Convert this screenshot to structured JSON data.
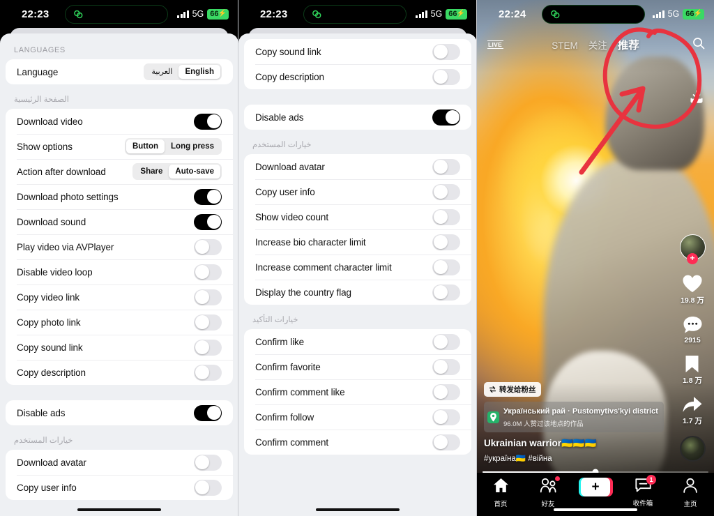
{
  "status_bar": {
    "time_left": "22:23",
    "time_right": "22:24",
    "network": "5G",
    "battery": "66",
    "charging_glyph": "⚡",
    "island_icon": "green-link-icon"
  },
  "panel1": {
    "sections": [
      {
        "header": "LANGUAGES",
        "rtl": false,
        "rows": [
          {
            "label": "Language",
            "control": "segmented",
            "options": [
              "العربية",
              "English"
            ],
            "selected": "English"
          }
        ]
      },
      {
        "header": "الصفحة الرئيسية",
        "rtl": true,
        "rows": [
          {
            "label": "Download video",
            "control": "toggle",
            "value": "on"
          },
          {
            "label": "Show options",
            "control": "segmented",
            "options": [
              "Button",
              "Long press"
            ],
            "selected": "Button"
          },
          {
            "label": "Action after download",
            "control": "segmented",
            "options": [
              "Share",
              "Auto-save"
            ],
            "selected": "Auto-save"
          },
          {
            "label": "Download photo settings",
            "control": "toggle",
            "value": "on"
          },
          {
            "label": "Download sound",
            "control": "toggle",
            "value": "on"
          },
          {
            "label": "Play video via AVPlayer",
            "control": "toggle",
            "value": "off"
          },
          {
            "label": "Disable video loop",
            "control": "toggle",
            "value": "off"
          },
          {
            "label": "Copy video link",
            "control": "toggle",
            "value": "off"
          },
          {
            "label": "Copy photo link",
            "control": "toggle",
            "value": "off"
          },
          {
            "label": "Copy sound link",
            "control": "toggle",
            "value": "off"
          },
          {
            "label": "Copy description",
            "control": "toggle",
            "value": "off"
          }
        ]
      },
      {
        "header": "",
        "rtl": false,
        "rows": [
          {
            "label": "Disable ads",
            "control": "toggle",
            "value": "on"
          }
        ]
      },
      {
        "header": "خيارات المستخدم",
        "rtl": true,
        "rows": [
          {
            "label": "Download avatar",
            "control": "toggle",
            "value": "off"
          },
          {
            "label": "Copy user info",
            "control": "toggle",
            "value": "off"
          }
        ]
      }
    ]
  },
  "panel2": {
    "sections": [
      {
        "header": "",
        "rtl": false,
        "rows": [
          {
            "label": "Copy sound link",
            "control": "toggle",
            "value": "off"
          },
          {
            "label": "Copy description",
            "control": "toggle",
            "value": "off"
          }
        ]
      },
      {
        "header": "",
        "rtl": false,
        "rows": [
          {
            "label": "Disable ads",
            "control": "toggle",
            "value": "on"
          }
        ]
      },
      {
        "header": "خيارات المستخدم",
        "rtl": true,
        "rows": [
          {
            "label": "Download avatar",
            "control": "toggle",
            "value": "off"
          },
          {
            "label": "Copy user info",
            "control": "toggle",
            "value": "off"
          },
          {
            "label": "Show video count",
            "control": "toggle",
            "value": "off"
          },
          {
            "label": "Increase bio character limit",
            "control": "toggle",
            "value": "off"
          },
          {
            "label": "Increase comment character limit",
            "control": "toggle",
            "value": "off"
          },
          {
            "label": "Display the country flag",
            "control": "toggle",
            "value": "off"
          }
        ]
      },
      {
        "header": "خيارات التأكيد",
        "rtl": true,
        "rows": [
          {
            "label": "Confirm like",
            "control": "toggle",
            "value": "off"
          },
          {
            "label": "Confirm favorite",
            "control": "toggle",
            "value": "off"
          },
          {
            "label": "Confirm comment like",
            "control": "toggle",
            "value": "off"
          },
          {
            "label": "Confirm follow",
            "control": "toggle",
            "value": "off"
          },
          {
            "label": "Confirm comment",
            "control": "toggle",
            "value": "off"
          }
        ]
      }
    ]
  },
  "panel3": {
    "top_bar": {
      "live_label": "LIVE",
      "tabs": [
        {
          "label": "STEM",
          "active": false
        },
        {
          "label": "关注",
          "active": false
        },
        {
          "label": "推荐",
          "active": true
        }
      ],
      "search_icon": "search-icon"
    },
    "download_icon": "download-icon",
    "annotation": {
      "color": "#e8333f",
      "shapes": [
        "circle-highlight",
        "arrow"
      ]
    },
    "rail": {
      "avatar_badge": "+",
      "items": [
        {
          "icon": "heart-icon",
          "count": "19.8 万"
        },
        {
          "icon": "comment-icon",
          "count": "2915"
        },
        {
          "icon": "bookmark-icon",
          "count": "1.8 万"
        },
        {
          "icon": "share-icon",
          "count": "1.7 万"
        }
      ]
    },
    "caption": {
      "repost_chip": "转发给粉丝",
      "location_name": "Український рай · Pustomytivs'kyi district",
      "location_sub": "96.0M 人赞过该地点的作品",
      "title": "Ukrainian warrior🇺🇦🇺🇦🇺🇦",
      "hashtags": "#україна🇺🇦 #війна"
    },
    "progress_percent": "50",
    "navbar": [
      {
        "icon": "home-icon",
        "label": "首页",
        "badge": ""
      },
      {
        "icon": "friends-icon",
        "label": "好友",
        "badge": "dot"
      },
      {
        "icon": "plus-icon",
        "label": "",
        "badge": ""
      },
      {
        "icon": "inbox-icon",
        "label": "收件箱",
        "badge": "1"
      },
      {
        "icon": "profile-icon",
        "label": "主页",
        "badge": ""
      }
    ]
  }
}
